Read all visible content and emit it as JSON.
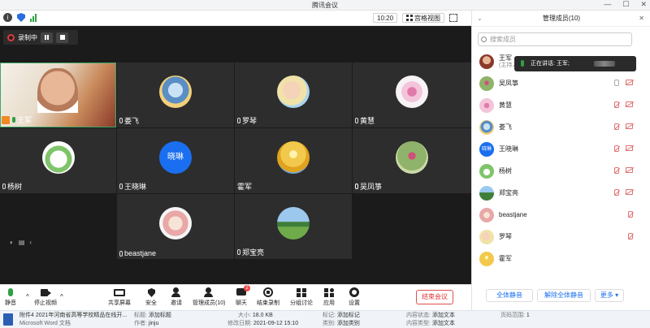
{
  "window": {
    "title": "腾讯会议"
  },
  "toolbar": {
    "time": "10:20",
    "view_label": "宫格视图"
  },
  "recording": {
    "label": "录制中"
  },
  "tiles": [
    {
      "name": "王军",
      "host": true,
      "mic": "green"
    },
    {
      "name": "娄飞",
      "mic": "off"
    },
    {
      "name": "罗琴",
      "mic": "off"
    },
    {
      "name": "黄慧",
      "mic": "off"
    },
    {
      "name": "杨树",
      "mic": "off"
    },
    {
      "name": "王晓琳",
      "avatar_text": "晓琳",
      "mic": "off"
    },
    {
      "name": "霍军",
      "mic": "none"
    },
    {
      "name": "吴凤箏",
      "mic": "on"
    },
    {
      "name": "beastjane",
      "mic": "off"
    },
    {
      "name": "郑宝亮",
      "mic": "off"
    }
  ],
  "bottombar": {
    "mute": "静音",
    "stop_video": "停止视频",
    "share": "共享屏幕",
    "security": "安全",
    "invite": "邀请",
    "manage": "管理成员(10)",
    "chat": "聊天",
    "chat_badge": "2",
    "end_record": "结束录制",
    "breakout": "分组讨论",
    "apps": "应用",
    "settings": "设置",
    "end_meeting": "结束会议"
  },
  "panel": {
    "title": "管理成员(10)",
    "search_placeholder": "搜索成员",
    "speaking_text": "正在讲话: 王军;",
    "members": [
      {
        "name": "王军",
        "role": "(主持人...",
        "state": "speaking"
      },
      {
        "name": "吴凤箏",
        "state": "mic_on"
      },
      {
        "name": "黄慧",
        "state": "muted"
      },
      {
        "name": "娄飞",
        "state": "muted"
      },
      {
        "name": "王晓琳",
        "avatar_text": "晓琳",
        "state": "muted"
      },
      {
        "name": "杨树",
        "state": "muted"
      },
      {
        "name": "郑宝亮",
        "state": "muted"
      },
      {
        "name": "beastjane",
        "state": "muted_nocam"
      },
      {
        "name": "罗琴",
        "state": "muted_nocam"
      },
      {
        "name": "霍军",
        "state": "none"
      }
    ],
    "mute_all": "全体静音",
    "unmute_all": "解除全体静音",
    "more": "更多 ▾"
  },
  "statusbar": {
    "file_name": "附件4 2021年河南省高等学校精品在线开...",
    "file_type": "Microsoft Word 文档",
    "title_k": "标题:",
    "title_v": "添加标题",
    "author_k": "作者:",
    "author_v": "jinju",
    "size_k": "大小:",
    "size_v": "18.0 KB",
    "modified_k": "修改日期:",
    "modified_v": "2021-09-12 15:10",
    "tags_k": "标记:",
    "tags_v": "添加标记",
    "category_k": "类别:",
    "category_v": "添加类别",
    "content_status_k": "内容状态:",
    "content_status_v": "添加文本",
    "content_type_k": "内容类型:",
    "content_type_v": "添加文本",
    "page_range_k": "页码范围:",
    "page_range_v": "1"
  }
}
